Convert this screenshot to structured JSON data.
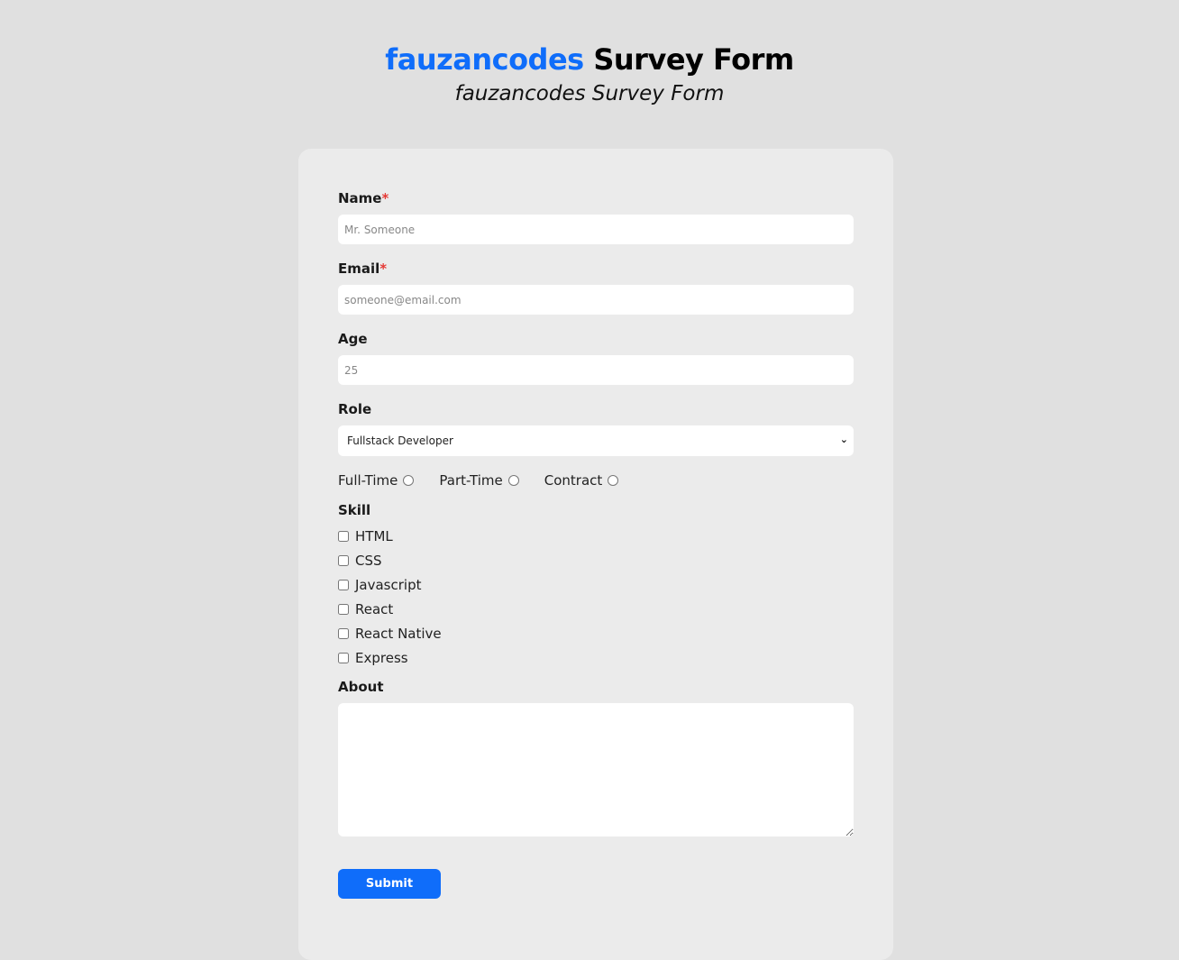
{
  "header": {
    "title_brand": "fauzancodes",
    "title_rest": "Survey Form",
    "subtitle": "fauzancodes Survey Form"
  },
  "colors": {
    "accent": "#0f6dfa",
    "required": "#e53935",
    "page_bg": "#e0e0e0",
    "card_bg": "#ebebeb"
  },
  "form": {
    "name": {
      "label": "Name",
      "required_mark": "*",
      "value": "",
      "placeholder": "Mr. Someone"
    },
    "email": {
      "label": "Email",
      "required_mark": "*",
      "value": "",
      "placeholder": "someone@email.com"
    },
    "age": {
      "label": "Age",
      "value": "",
      "placeholder": "25"
    },
    "role": {
      "label": "Role",
      "selected": "Fullstack Developer"
    },
    "employment": [
      {
        "label": "Full-Time",
        "checked": false
      },
      {
        "label": "Part-Time",
        "checked": false
      },
      {
        "label": "Contract",
        "checked": false
      }
    ],
    "skill": {
      "label": "Skill",
      "options": [
        {
          "label": "HTML",
          "checked": false
        },
        {
          "label": "CSS",
          "checked": false
        },
        {
          "label": "Javascript",
          "checked": false
        },
        {
          "label": "React",
          "checked": false
        },
        {
          "label": "React Native",
          "checked": false
        },
        {
          "label": "Express",
          "checked": false
        }
      ]
    },
    "about": {
      "label": "About",
      "value": ""
    },
    "submit_label": "Submit"
  }
}
